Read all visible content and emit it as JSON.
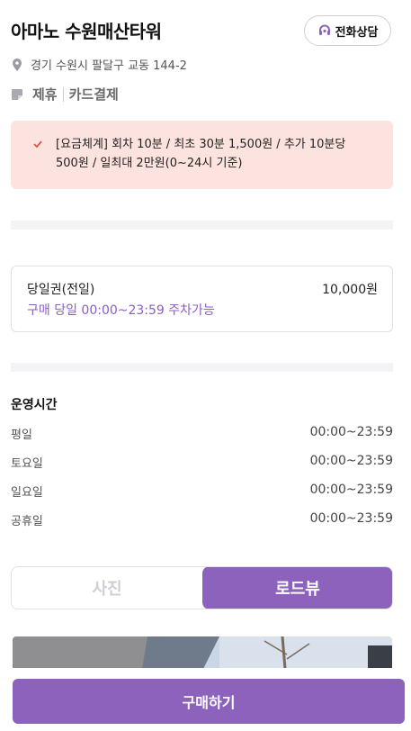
{
  "header": {
    "title": "아마노 수원매산타워",
    "call_button_label": "전화상담",
    "call_icon": "headset-icon"
  },
  "address": {
    "icon": "location-pin-icon",
    "text": "경기 수원시 팔달구 교동 144-2"
  },
  "tags": {
    "icon": "tag-icon",
    "items": [
      "제휴",
      "카드결제"
    ]
  },
  "notice": {
    "icon": "check-icon",
    "line1": "[요금체계] 회차 10분 / 최초 30분 1,500원 / 추가 10분당",
    "line2": "500원 / 일최대 2만원(0~24시 기준)"
  },
  "ticket": {
    "name": "당일권(전일)",
    "price": "10,000원",
    "description": "구매 당일 00:00~23:59 주차가능"
  },
  "hours": {
    "title": "운영시간",
    "rows": [
      {
        "day": "평일",
        "time": "00:00~23:59"
      },
      {
        "day": "토요일",
        "time": "00:00~23:59"
      },
      {
        "day": "일요일",
        "time": "00:00~23:59"
      },
      {
        "day": "공휴일",
        "time": "00:00~23:59"
      }
    ]
  },
  "media_tabs": {
    "items": [
      "사진",
      "로드뷰"
    ],
    "selected": "로드뷰"
  },
  "footer": {
    "buy_label": "구매하기"
  },
  "colors": {
    "accent": "#8d62bd",
    "notice_bg": "#fde3df",
    "check": "#e0584b"
  }
}
